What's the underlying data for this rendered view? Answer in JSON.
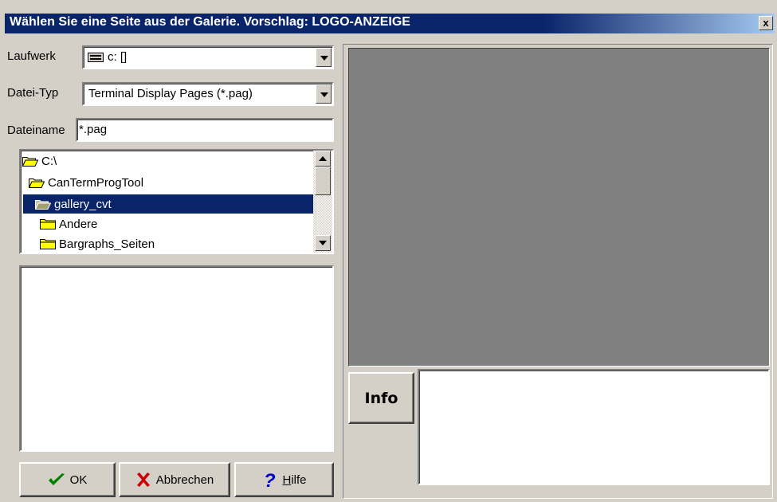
{
  "window": {
    "title": "Wählen Sie eine Seite aus der Galerie.  Vorschlag: LOGO-ANZEIGE",
    "close_label": "x"
  },
  "drive": {
    "label": "Laufwerk",
    "value": "c: []",
    "icon": "drive-icon"
  },
  "file_type": {
    "label": "Datei-Typ",
    "value": "Terminal Display Pages  (*.pag)"
  },
  "file_name": {
    "label": "Dateiname",
    "value": "*.pag"
  },
  "folders": [
    {
      "label": "C:\\",
      "icon": "open-folder-icon",
      "selected": false
    },
    {
      "label": "CanTermProgTool",
      "icon": "open-folder-icon",
      "selected": false
    },
    {
      "label": "gallery_cvt",
      "icon": "open-folder-icon",
      "selected": true
    },
    {
      "label": "Andere",
      "icon": "folder-icon",
      "selected": false
    },
    {
      "label": "Bargraphs_Seiten",
      "icon": "folder-icon",
      "selected": false
    }
  ],
  "info": {
    "label": "Info"
  },
  "buttons": {
    "ok": "OK",
    "cancel": "Abbrechen",
    "help_prefix": "",
    "help_underlined": "H",
    "help_rest": "ilfe"
  },
  "colors": {
    "titlebar": "#0a246a",
    "selection": "#0a246a",
    "preview": "#808080",
    "dialog": "#d4d0c8",
    "folder": "#ffff00",
    "ok_check": "#008000",
    "cancel_x": "#cc0000",
    "help_q": "#0000cc"
  }
}
